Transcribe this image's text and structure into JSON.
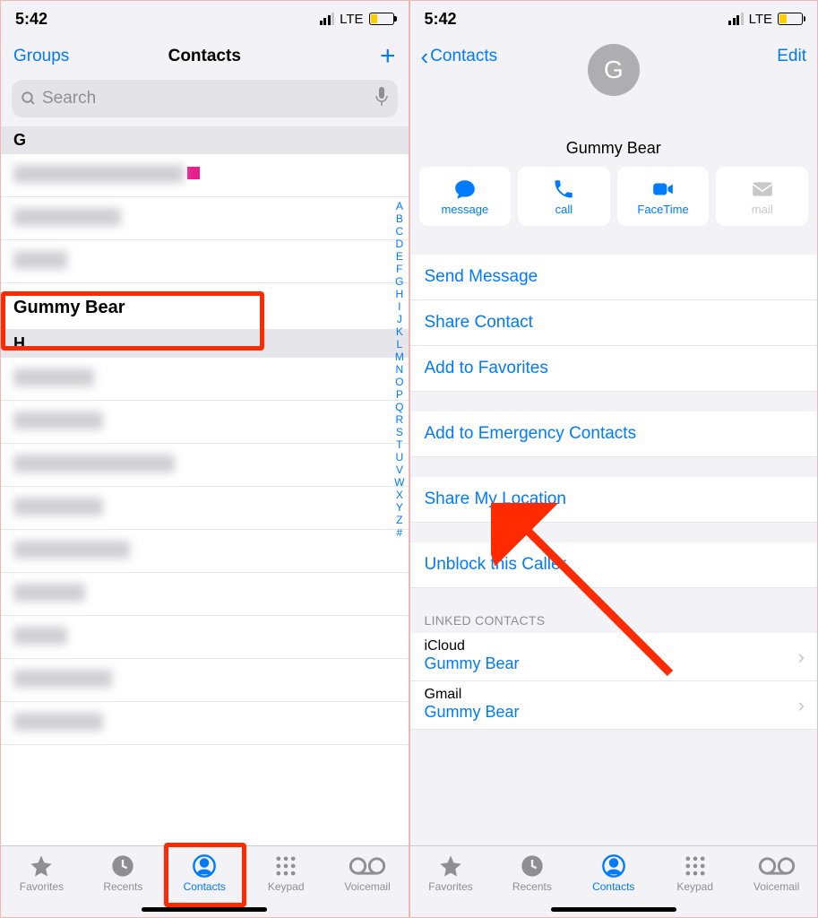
{
  "status": {
    "time": "5:42",
    "network": "LTE"
  },
  "left": {
    "groups": "Groups",
    "title": "Contacts",
    "search_placeholder": "Search",
    "sections": {
      "g": "G",
      "h": "H"
    },
    "gummy": "Gummy Bear",
    "index": [
      "A",
      "B",
      "C",
      "D",
      "E",
      "F",
      "G",
      "H",
      "I",
      "J",
      "K",
      "L",
      "M",
      "N",
      "O",
      "P",
      "Q",
      "R",
      "S",
      "T",
      "U",
      "V",
      "W",
      "X",
      "Y",
      "Z",
      "#"
    ]
  },
  "tabs": {
    "favorites": "Favorites",
    "recents": "Recents",
    "contacts": "Contacts",
    "keypad": "Keypad",
    "voicemail": "Voicemail"
  },
  "right": {
    "back": "Contacts",
    "edit": "Edit",
    "avatar_initial": "G",
    "name": "Gummy Bear",
    "actions": {
      "message": "message",
      "call": "call",
      "facetime": "FaceTime",
      "mail": "mail"
    },
    "links": {
      "send_message": "Send Message",
      "share_contact": "Share Contact",
      "add_favorites": "Add to Favorites",
      "add_emergency": "Add to Emergency Contacts",
      "share_location": "Share My Location",
      "unblock": "Unblock this Caller"
    },
    "linked_title": "Linked Contacts",
    "linked": [
      {
        "source": "iCloud",
        "value": "Gummy Bear"
      },
      {
        "source": "Gmail",
        "value": "Gummy Bear"
      }
    ]
  }
}
